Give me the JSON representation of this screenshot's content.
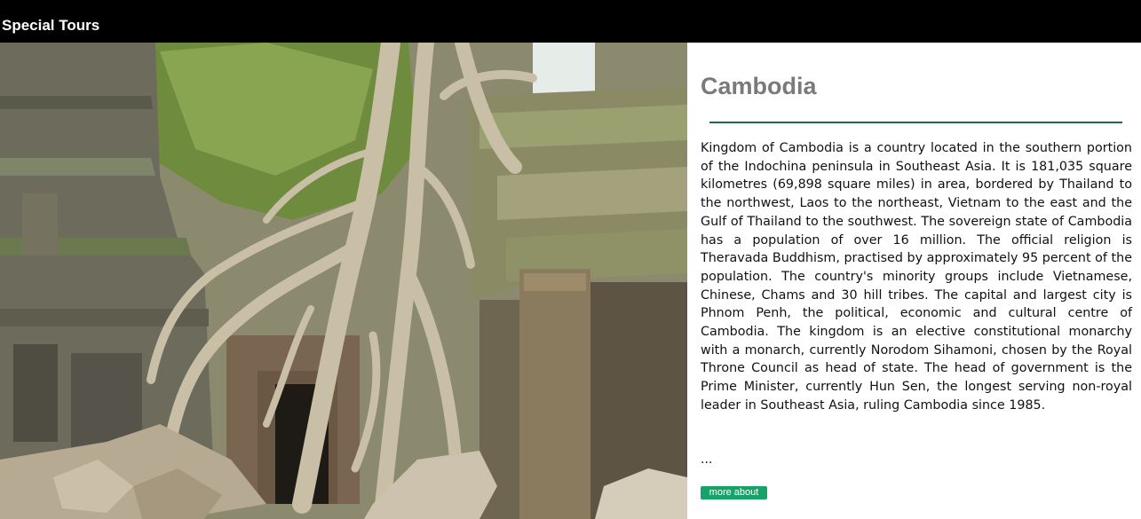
{
  "header": {
    "brand": "Special Tours"
  },
  "hero_image": {
    "alt": "Ancient temple ruins overgrown by giant tree roots"
  },
  "article": {
    "title": "Cambodia",
    "description": "Kingdom of Cambodia is a country located in the southern portion of the Indochina peninsula in Southeast Asia. It is 181,035 square kilometres (69,898 square miles) in area, bordered by Thailand to the northwest, Laos to the northeast, Vietnam to the east and the Gulf of Thailand to the southwest. The sovereign state of Cambodia has a population of over 16 million. The official religion is Theravada Buddhism, practised by approximately 95 percent of the population. The country's minority groups include Vietnamese, Chinese, Chams and 30 hill tribes. The capital and largest city is Phnom Penh, the political, economic and cultural centre of Cambodia. The kingdom is an elective constitutional monarchy with a monarch, currently Norodom Sihamoni, chosen by the Royal Throne Council as head of state. The head of government is the Prime Minister, currently Hun Sen, the longest serving non-royal leader in Southeast Asia, ruling Cambodia since 1985.",
    "ellipsis": "...",
    "more_label": "more about"
  },
  "colors": {
    "header_bg": "#000000",
    "accent_rule": "#1e6b4f",
    "button_bg": "#17a26a",
    "title_text": "#7a7a7a"
  }
}
